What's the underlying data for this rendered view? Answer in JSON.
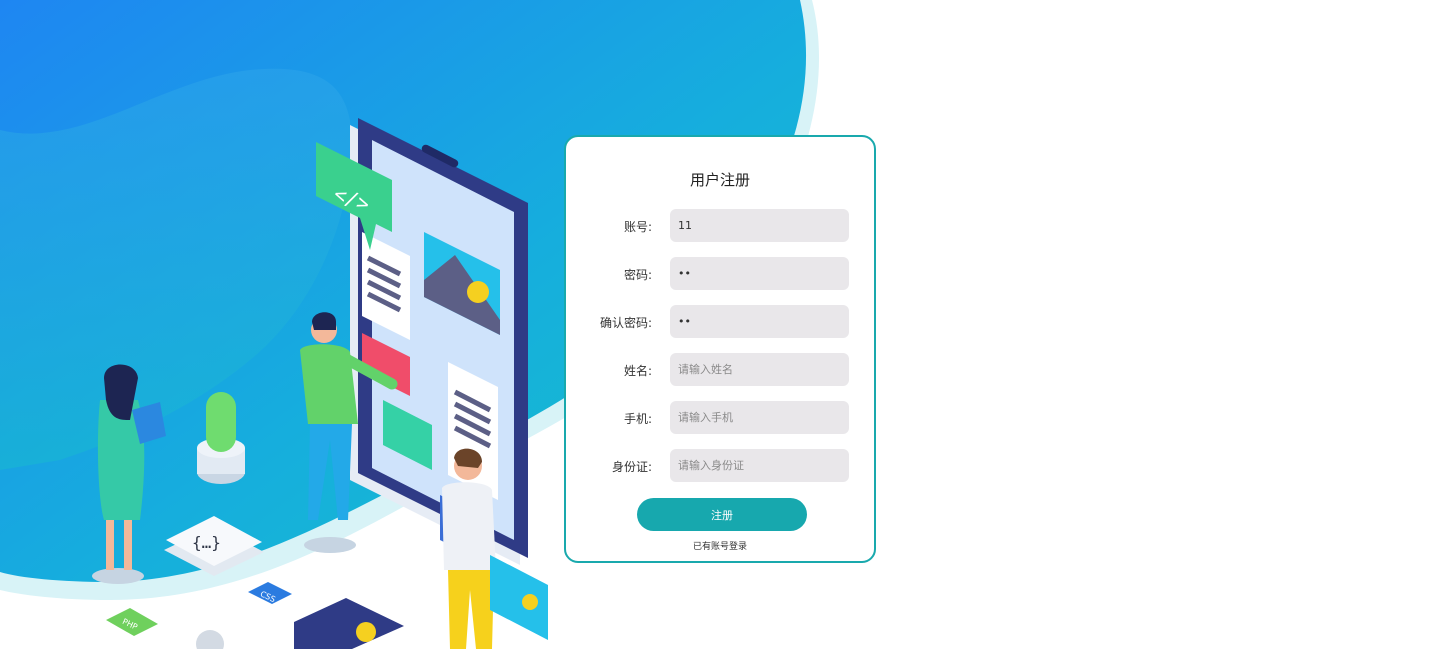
{
  "form": {
    "title": "用户注册",
    "fields": [
      {
        "label": "账号:",
        "value": "11",
        "placeholder": "",
        "type": "text"
      },
      {
        "label": "密码:",
        "value": "••",
        "placeholder": "",
        "type": "text"
      },
      {
        "label": "确认密码:",
        "value": "••",
        "placeholder": "",
        "type": "text"
      },
      {
        "label": "姓名:",
        "value": "",
        "placeholder": "请输入姓名",
        "type": "text"
      },
      {
        "label": "手机:",
        "value": "",
        "placeholder": "请输入手机",
        "type": "text"
      },
      {
        "label": "身份证:",
        "value": "",
        "placeholder": "请输入身份证",
        "type": "text"
      }
    ],
    "submit_label": "注册",
    "login_link": "已有账号登录"
  },
  "illustration": {
    "code_badge": "</>",
    "css_tag": "CSS",
    "php_tag": "PHP"
  },
  "colors": {
    "accent": "#17a8ae",
    "gradient_start": "#1c8cf0",
    "gradient_end": "#19c3c9",
    "input_bg": "#e9e7ea"
  }
}
